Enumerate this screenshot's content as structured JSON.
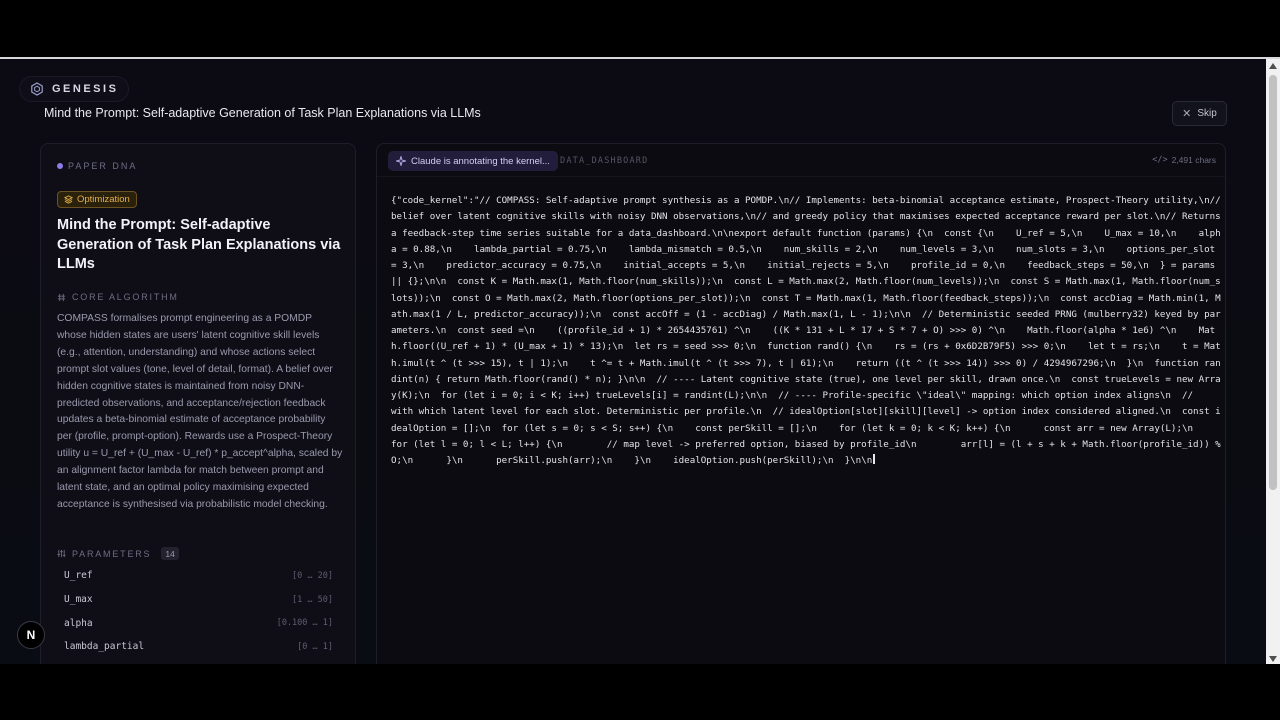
{
  "brand": {
    "name": "GENESIS"
  },
  "paper": {
    "title": "Mind the Prompt: Self-adaptive Generation of Task Plan Explanations via LLMs"
  },
  "skip": {
    "label": "Skip"
  },
  "left_panel": {
    "section_label": "PAPER DNA",
    "tag": "Optimization",
    "card_title": "Mind the Prompt: Self-adaptive Generation of Task Plan Explanations via LLMs",
    "algo_header": "CORE ALGORITHM",
    "algo_text": "COMPASS formalises prompt engineering as a POMDP whose hidden states are users' latent cognitive skill levels (e.g., attention, understanding) and whose actions select prompt slot values (tone, level of detail, format). A belief over hidden cognitive states is maintained from noisy DNN-predicted observations, and acceptance/rejection feedback updates a beta-binomial estimate of acceptance probability per (profile, prompt-option). Rewards use a Prospect-Theory utility u = U_ref + (U_max - U_ref) * p_accept^alpha, scaled by an alignment factor lambda for match between prompt and latent state, and an optimal policy maximising expected acceptance is synthesised via probabilistic model checking.",
    "params_header": "PARAMETERS",
    "params_count": "14",
    "params": [
      {
        "name": "U_ref",
        "range": "[0 … 20]"
      },
      {
        "name": "U_max",
        "range": "[1 … 50]"
      },
      {
        "name": "alpha",
        "range": "[0.100 … 1]"
      },
      {
        "name": "lambda_partial",
        "range": "[0 … 1]"
      }
    ]
  },
  "right_panel": {
    "status": "Claude is annotating the kernel...",
    "dashboard_label": "DATA_DASHBOARD",
    "char_count": "2,491 chars",
    "code": "{\"code_kernel\":\"// COMPASS: Self-adaptive prompt synthesis as a POMDP.\\n// Implements: beta-binomial acceptance estimate, Prospect-Theory utility,\\n// belief over latent cognitive skills with noisy DNN observations,\\n// and greedy policy that maximises expected acceptance reward per slot.\\n// Returns a feedback-step time series suitable for a data_dashboard.\\n\\nexport default function (params) {\\n  const {\\n    U_ref = 5,\\n    U_max = 10,\\n    alpha = 0.88,\\n    lambda_partial = 0.75,\\n    lambda_mismatch = 0.5,\\n    num_skills = 2,\\n    num_levels = 3,\\n    num_slots = 3,\\n    options_per_slot = 3,\\n    predictor_accuracy = 0.75,\\n    initial_accepts = 5,\\n    initial_rejects = 5,\\n    profile_id = 0,\\n    feedback_steps = 50,\\n  } = params || {};\\n\\n  const K = Math.max(1, Math.floor(num_skills));\\n  const L = Math.max(2, Math.floor(num_levels));\\n  const S = Math.max(1, Math.floor(num_slots));\\n  const O = Math.max(2, Math.floor(options_per_slot));\\n  const T = Math.max(1, Math.floor(feedback_steps));\\n  const accDiag = Math.min(1, Math.max(1 / L, predictor_accuracy));\\n  const accOff = (1 - accDiag) / Math.max(1, L - 1);\\n\\n  // Deterministic seeded PRNG (mulberry32) keyed by parameters.\\n  const seed =\\n    ((profile_id + 1) * 2654435761) ^\\n    ((K * 131 + L * 17 + S * 7 + O) >>> 0) ^\\n    Math.floor(alpha * 1e6) ^\\n    Math.floor((U_ref + 1) * (U_max + 1) * 13);\\n  let rs = seed >>> 0;\\n  function rand() {\\n    rs = (rs + 0x6D2B79F5) >>> 0;\\n    let t = rs;\\n    t = Math.imul(t ^ (t >>> 15), t | 1);\\n    t ^= t + Math.imul(t ^ (t >>> 7), t | 61);\\n    return ((t ^ (t >>> 14)) >>> 0) / 4294967296;\\n  }\\n  function randint(n) { return Math.floor(rand() * n); }\\n\\n  // ---- Latent cognitive state (true), one level per skill, drawn once.\\n  const trueLevels = new Array(K);\\n  for (let i = 0; i < K; i++) trueLevels[i] = randint(L);\\n\\n  // ---- Profile-specific \\\"ideal\\\" mapping: which option index aligns\\n  //      with which latent level for each slot. Deterministic per profile.\\n  // idealOption[slot][skill][level] -> option index considered aligned.\\n  const idealOption = [];\\n  for (let s = 0; s < S; s++) {\\n    const perSkill = [];\\n    for (let k = 0; k < K; k++) {\\n      const arr = new Array(L);\\n      for (let l = 0; l < L; l++) {\\n        // map level -> preferred option, biased by profile_id\\n        arr[l] = (l + s + k + Math.floor(profile_id)) % O;\\n      }\\n      perSkill.push(arr);\\n    }\\n    idealOption.push(perSkill);\\n  }\\n\\n"
  }
}
